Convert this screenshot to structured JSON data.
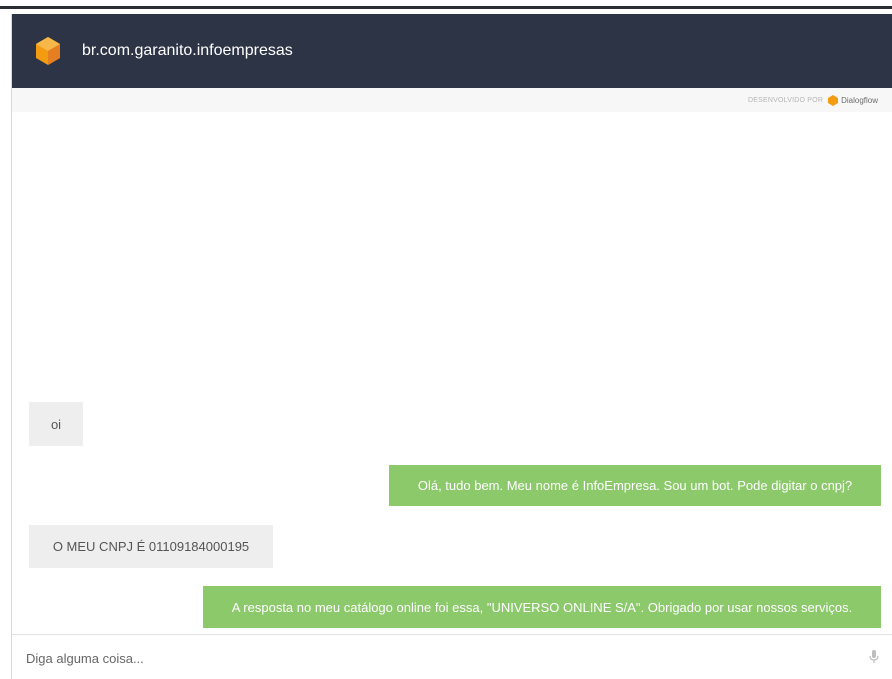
{
  "header": {
    "title": "br.com.garanito.infoempresas",
    "logo_icon": "orange-cube-icon",
    "background": "#2d3446"
  },
  "powered_by": {
    "label": "DESENVOLVIDO POR",
    "brand": "Dialogflow",
    "brand_icon": "dialogflow-icon"
  },
  "messages": [
    {
      "sender": "user",
      "text": "oi"
    },
    {
      "sender": "bot",
      "text": "Olá, tudo bem. Meu nome é InfoEmpresa. Sou um bot. Pode digitar o cnpj?"
    },
    {
      "sender": "user",
      "text": "O MEU CNPJ É 01109184000195"
    },
    {
      "sender": "bot",
      "text": "A resposta no meu catálogo online foi essa, \"UNIVERSO ONLINE S/A\". Obrigado por usar nossos serviços."
    }
  ],
  "input": {
    "placeholder": "Diga alguma coisa...",
    "value": "",
    "mic_icon": "microphone-icon"
  },
  "colors": {
    "bot_bubble": "#8bc96b",
    "user_bubble": "#eeeeee",
    "accent": "#f39c12"
  }
}
